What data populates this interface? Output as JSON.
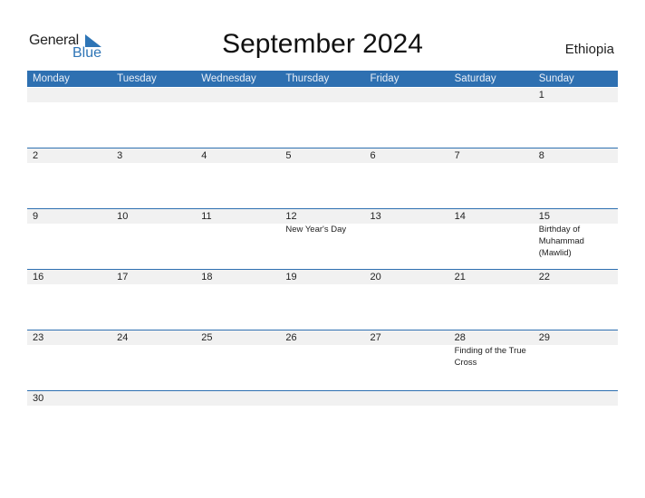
{
  "logo": {
    "general": "General",
    "blue": "Blue"
  },
  "title": "September 2024",
  "country": "Ethiopia",
  "days": [
    "Monday",
    "Tuesday",
    "Wednesday",
    "Thursday",
    "Friday",
    "Saturday",
    "Sunday"
  ],
  "weeks": [
    [
      {
        "d": ""
      },
      {
        "d": ""
      },
      {
        "d": ""
      },
      {
        "d": ""
      },
      {
        "d": ""
      },
      {
        "d": ""
      },
      {
        "d": "1"
      }
    ],
    [
      {
        "d": "2"
      },
      {
        "d": "3"
      },
      {
        "d": "4"
      },
      {
        "d": "5"
      },
      {
        "d": "6"
      },
      {
        "d": "7"
      },
      {
        "d": "8"
      }
    ],
    [
      {
        "d": "9"
      },
      {
        "d": "10"
      },
      {
        "d": "11"
      },
      {
        "d": "12",
        "e": "New Year's Day"
      },
      {
        "d": "13"
      },
      {
        "d": "14"
      },
      {
        "d": "15",
        "e": "Birthday of Muhammad (Mawlid)"
      }
    ],
    [
      {
        "d": "16"
      },
      {
        "d": "17"
      },
      {
        "d": "18"
      },
      {
        "d": "19"
      },
      {
        "d": "20"
      },
      {
        "d": "21"
      },
      {
        "d": "22"
      }
    ],
    [
      {
        "d": "23"
      },
      {
        "d": "24"
      },
      {
        "d": "25"
      },
      {
        "d": "26"
      },
      {
        "d": "27"
      },
      {
        "d": "28",
        "e": "Finding of the True Cross"
      },
      {
        "d": "29"
      }
    ],
    [
      {
        "d": "30"
      },
      {
        "d": ""
      },
      {
        "d": ""
      },
      {
        "d": ""
      },
      {
        "d": ""
      },
      {
        "d": ""
      },
      {
        "d": ""
      }
    ]
  ]
}
